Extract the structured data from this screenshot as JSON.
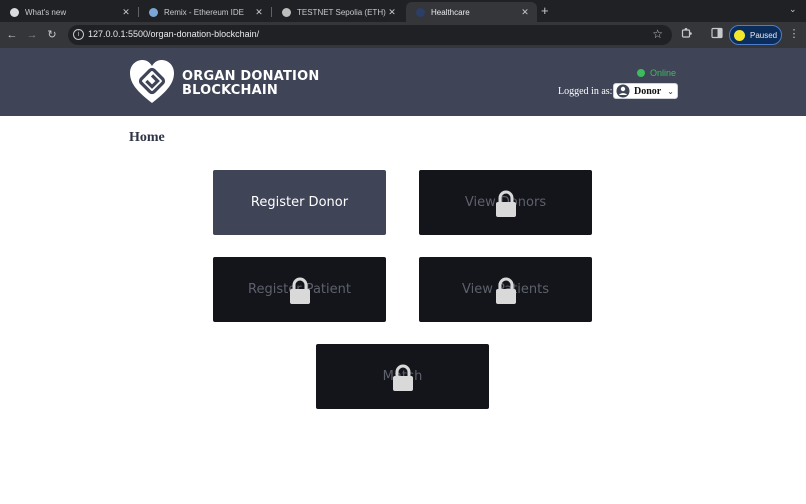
{
  "browser": {
    "tabs": [
      {
        "title": "What's new",
        "favicon_color": "#dadce0",
        "active": false
      },
      {
        "title": "Remix - Ethereum IDE",
        "favicon_color": "#7aa7d8",
        "active": false
      },
      {
        "title": "TESTNET Sepolia (ETH) Block",
        "favicon_color": "#bdbdbd",
        "active": false
      },
      {
        "title": "Healthcare",
        "favicon_color": "#2d3e66",
        "active": true
      }
    ],
    "url": "127.0.0.1:5500/organ-donation-blockchain/",
    "profile_label": "Paused"
  },
  "header": {
    "brand_line1": "ORGAN DONATION",
    "brand_line2": "BLOCKCHAIN",
    "status": "Online",
    "status_color": "#3dbb5d",
    "logged_in_label": "Logged in as:",
    "role_value": "Donor"
  },
  "main": {
    "title": "Home",
    "tiles": [
      {
        "label": "Register Donor",
        "locked": false
      },
      {
        "label": "View Donors",
        "locked": true
      },
      {
        "label": "Register Patient",
        "locked": true
      },
      {
        "label": "View Patients",
        "locked": true
      },
      {
        "label": "Match",
        "locked": true
      }
    ]
  },
  "colors": {
    "header_bg": "#3f4457",
    "tile_open": "#3f4457",
    "tile_locked": "#13151b"
  }
}
